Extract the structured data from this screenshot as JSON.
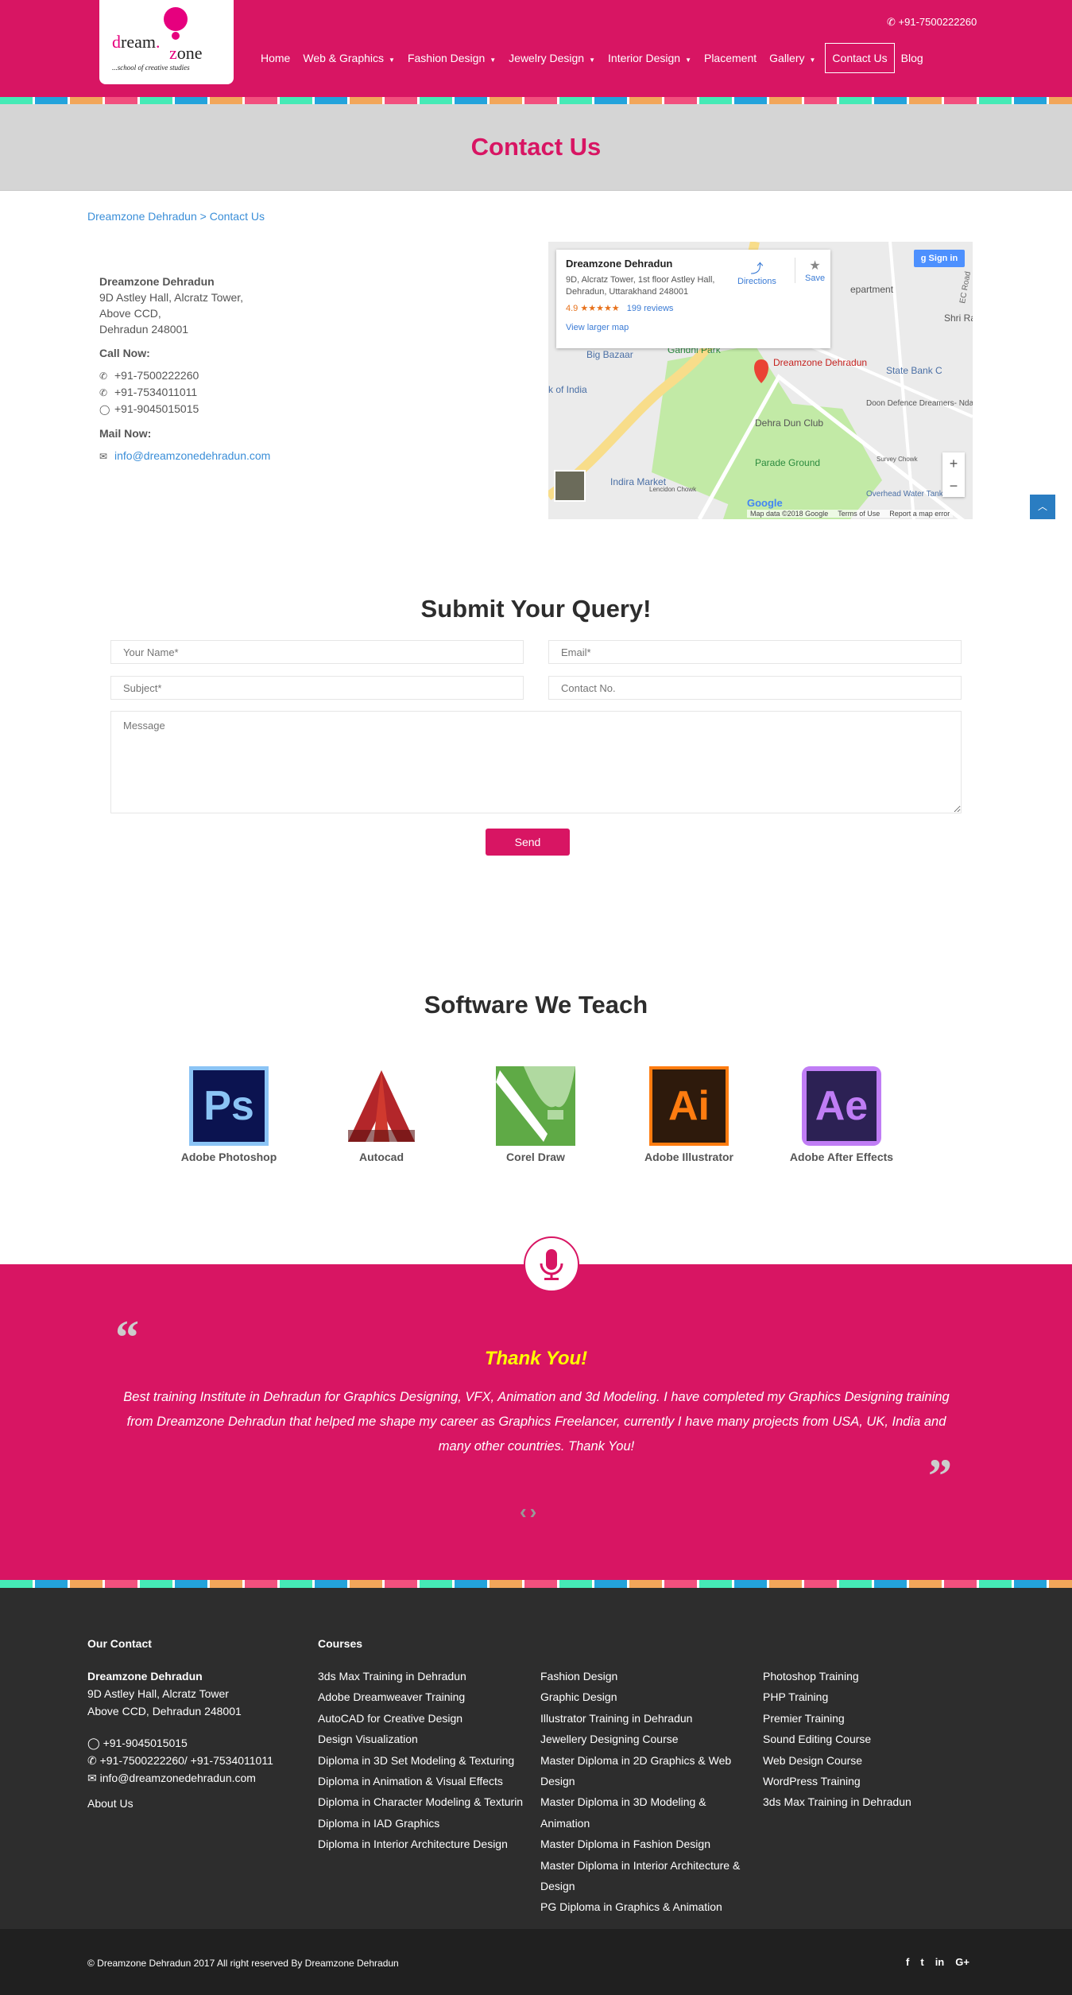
{
  "brand": {
    "logo_word1": "dream",
    "logo_word2": "zone",
    "tagline": "...school of creative studies",
    "primary": "#d81563",
    "stripe_colors": [
      "#45eab6",
      "#23a3dc",
      "#f2a65a",
      "#f2507e"
    ]
  },
  "header": {
    "phone": "+91-7500222260",
    "nav": [
      {
        "label": "Home",
        "dropdown": false
      },
      {
        "label": "Web & Graphics",
        "dropdown": true
      },
      {
        "label": "Fashion Design",
        "dropdown": true
      },
      {
        "label": "Jewelry Design",
        "dropdown": true
      },
      {
        "label": "Interior Design",
        "dropdown": true
      },
      {
        "label": "Placement",
        "dropdown": false
      },
      {
        "label": "Gallery",
        "dropdown": true
      },
      {
        "label": "Contact Us",
        "dropdown": false,
        "active": true
      },
      {
        "label": "Blog",
        "dropdown": false
      }
    ]
  },
  "page_title": "Contact Us",
  "breadcrumb": {
    "home": "Dreamzone Dehradun",
    "sep": ">",
    "current": "Contact Us"
  },
  "contact": {
    "name": "Dreamzone Dehradun",
    "address": [
      "9D Astley Hall, Alcratz Tower,",
      "Above CCD,",
      "Dehradun 248001"
    ],
    "call_label": "Call Now:",
    "phones": [
      "+91-7500222260",
      "+91-7534011011"
    ],
    "whatsapp": "+91-9045015015",
    "mail_label": "Mail Now:",
    "email": "info@dreamzonedehradun.com"
  },
  "map": {
    "place": "Dreamzone Dehradun",
    "address": "9D, Alcratz Tower, 1st floor Astley Hall, Dehradun, Uttarakhand 248001",
    "rating": "4.9",
    "stars": "★★★★★",
    "reviews": "199 reviews",
    "directions": "Directions",
    "save": "Save",
    "larger": "View larger map",
    "signin": "Sign in",
    "labels": {
      "big_bazaar": "Big Bazaar",
      "gandhi_park": "Gandhi Park",
      "bank": "k of India",
      "dehra_dun_club": "Dehra Dun Club",
      "parade_ground": "Parade Ground",
      "indira_market": "Indira Market",
      "state_bank": "State Bank C",
      "doon_defence": "Doon Defence Dreamers- Nda...",
      "overhead": "Overhead Water Tank",
      "survey": "Survey Chowk",
      "lencidon": "Lencidon Chowk",
      "department": "epartment",
      "shri_rai": "Shri Rai",
      "ec_road": "EC Road"
    },
    "footer": [
      "Map data ©2018 Google",
      "Terms of Use",
      "Report a map error"
    ],
    "google": "Google"
  },
  "form": {
    "title": "Submit Your Query!",
    "name_ph": "Your Name*",
    "email_ph": "Email*",
    "subject_ph": "Subject*",
    "contact_ph": "Contact No.",
    "message_ph": "Message",
    "send": "Send"
  },
  "software": {
    "title": "Software We Teach",
    "items": [
      {
        "name": "Adobe Photoshop",
        "abbr": "Ps"
      },
      {
        "name": "Autocad",
        "abbr": ""
      },
      {
        "name": "Corel Draw",
        "abbr": ""
      },
      {
        "name": "Adobe Illustrator",
        "abbr": "Ai"
      },
      {
        "name": "Adobe After Effects",
        "abbr": "Ae"
      }
    ]
  },
  "testimonial": {
    "heading": "Thank You!",
    "text": "Best training Institute in Dehradun for Graphics Designing, VFX, Animation and 3d Modeling. I have completed my Graphics Designing training from Dreamzone Dehradun that helped me shape my career as Graphics Freelancer, currently I have many projects from USA, UK, India and many other countries. Thank You!"
  },
  "footer": {
    "contact_title": "Our Contact",
    "name": "Dreamzone Dehradun",
    "address": [
      "9D Astley Hall, Alcratz Tower",
      "Above CCD, Dehradun 248001"
    ],
    "whatsapp": "+91-9045015015",
    "phones": "+91-7500222260/ +91-7534011011",
    "email": "info@dreamzonedehradun.com",
    "about": "About Us",
    "courses_title": "Courses",
    "courses": [
      [
        "3ds Max Training in Dehradun",
        "Adobe Dreamweaver Training",
        "AutoCAD for Creative Design",
        "Design Visualization",
        "Diploma in 3D Set Modeling & Texturing",
        "Diploma in Animation & Visual Effects",
        "Diploma in Character Modeling & Texturin",
        "Diploma in IAD Graphics",
        "Diploma in Interior Architecture Design"
      ],
      [
        "Fashion Design",
        "Graphic Design",
        "Illustrator Training in Dehradun",
        "Jewellery Designing Course",
        "Master Diploma in 2D Graphics & Web Design",
        "Master Diploma in 3D Modeling & Animation",
        "Master Diploma in Fashion Design",
        "Master Diploma in Interior Architecture & Design",
        "PG Diploma in Graphics & Animation"
      ],
      [
        "Photoshop Training",
        "PHP Training",
        "Premier Training",
        "Sound Editing Course",
        "Web Design Course",
        "WordPress Training",
        "3ds Max Training in Dehradun"
      ]
    ],
    "copyright": "© Dreamzone Dehradun 2017 All right reserved By Dreamzone Dehradun",
    "social": [
      "facebook",
      "twitter",
      "linkedin",
      "google-plus"
    ]
  }
}
